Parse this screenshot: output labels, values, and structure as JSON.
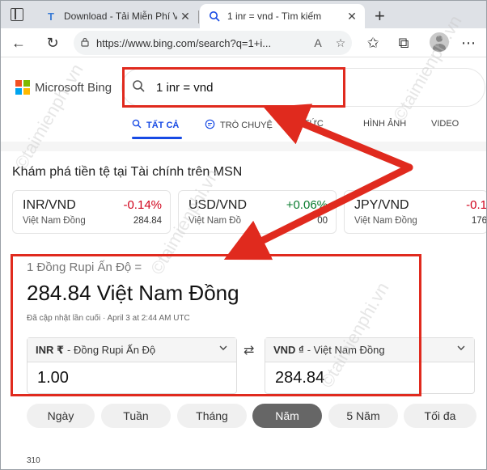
{
  "browser": {
    "tabs": [
      {
        "title": "Download - Tải Miễn Phí VN -",
        "icon": "taimienphi-favicon"
      },
      {
        "title": "1 inr = vnd - Tìm kiếm",
        "icon": "search-favicon"
      }
    ],
    "address_bar": {
      "url": "https://www.bing.com/search?q=1+i..."
    }
  },
  "bing": {
    "logo_text": "Microsoft Bing",
    "search_query": "1 inr = vnd",
    "nav": {
      "all": "TẤT CẢ",
      "chat": "TRÒ CHUYỆ",
      "news": "N TỨC",
      "images": "HÌNH ẢNH",
      "video": "VIDEO"
    }
  },
  "msn": {
    "title": "Khám phá tiền tệ tại Tài chính trên MSN",
    "cards": [
      {
        "pair": "INR/VND",
        "change": "-0.14%",
        "name": "Việt Nam Đồng",
        "rate": "284.84",
        "change_color": "#d0021b"
      },
      {
        "pair": "USD/VND",
        "change": "+0.06%",
        "name": "Việt Nam Đồ",
        "rate": "00",
        "change_color": "#0a7c2f"
      },
      {
        "pair": "JPY/VND",
        "change": "-0.1",
        "name": "Việt Nam Đồng",
        "rate": "176",
        "change_color": "#d0021b"
      }
    ]
  },
  "converter": {
    "from_text": "1 Đồng Rupi Ấn Độ =",
    "result_text": "284.84 Việt Nam Đồng",
    "updated": "Đã cập nhật lần cuối · April 3 at 2:44 AM UTC",
    "from_code": "INR ₹",
    "from_name": "- Đồng Rupi Ấn Độ",
    "from_amount": "1.00",
    "to_code": "VND ₫",
    "to_name": "- Việt Nam Đồng",
    "to_amount": "284.84",
    "ranges": [
      "Ngày",
      "Tuần",
      "Tháng",
      "Năm",
      "5 Năm",
      "Tối đa"
    ],
    "active_range": "Năm",
    "chart_tick": "310"
  },
  "watermark": "©taimienphi.vn",
  "colors": {
    "accent": "#174ae4",
    "annotation": "#e02a1e"
  }
}
